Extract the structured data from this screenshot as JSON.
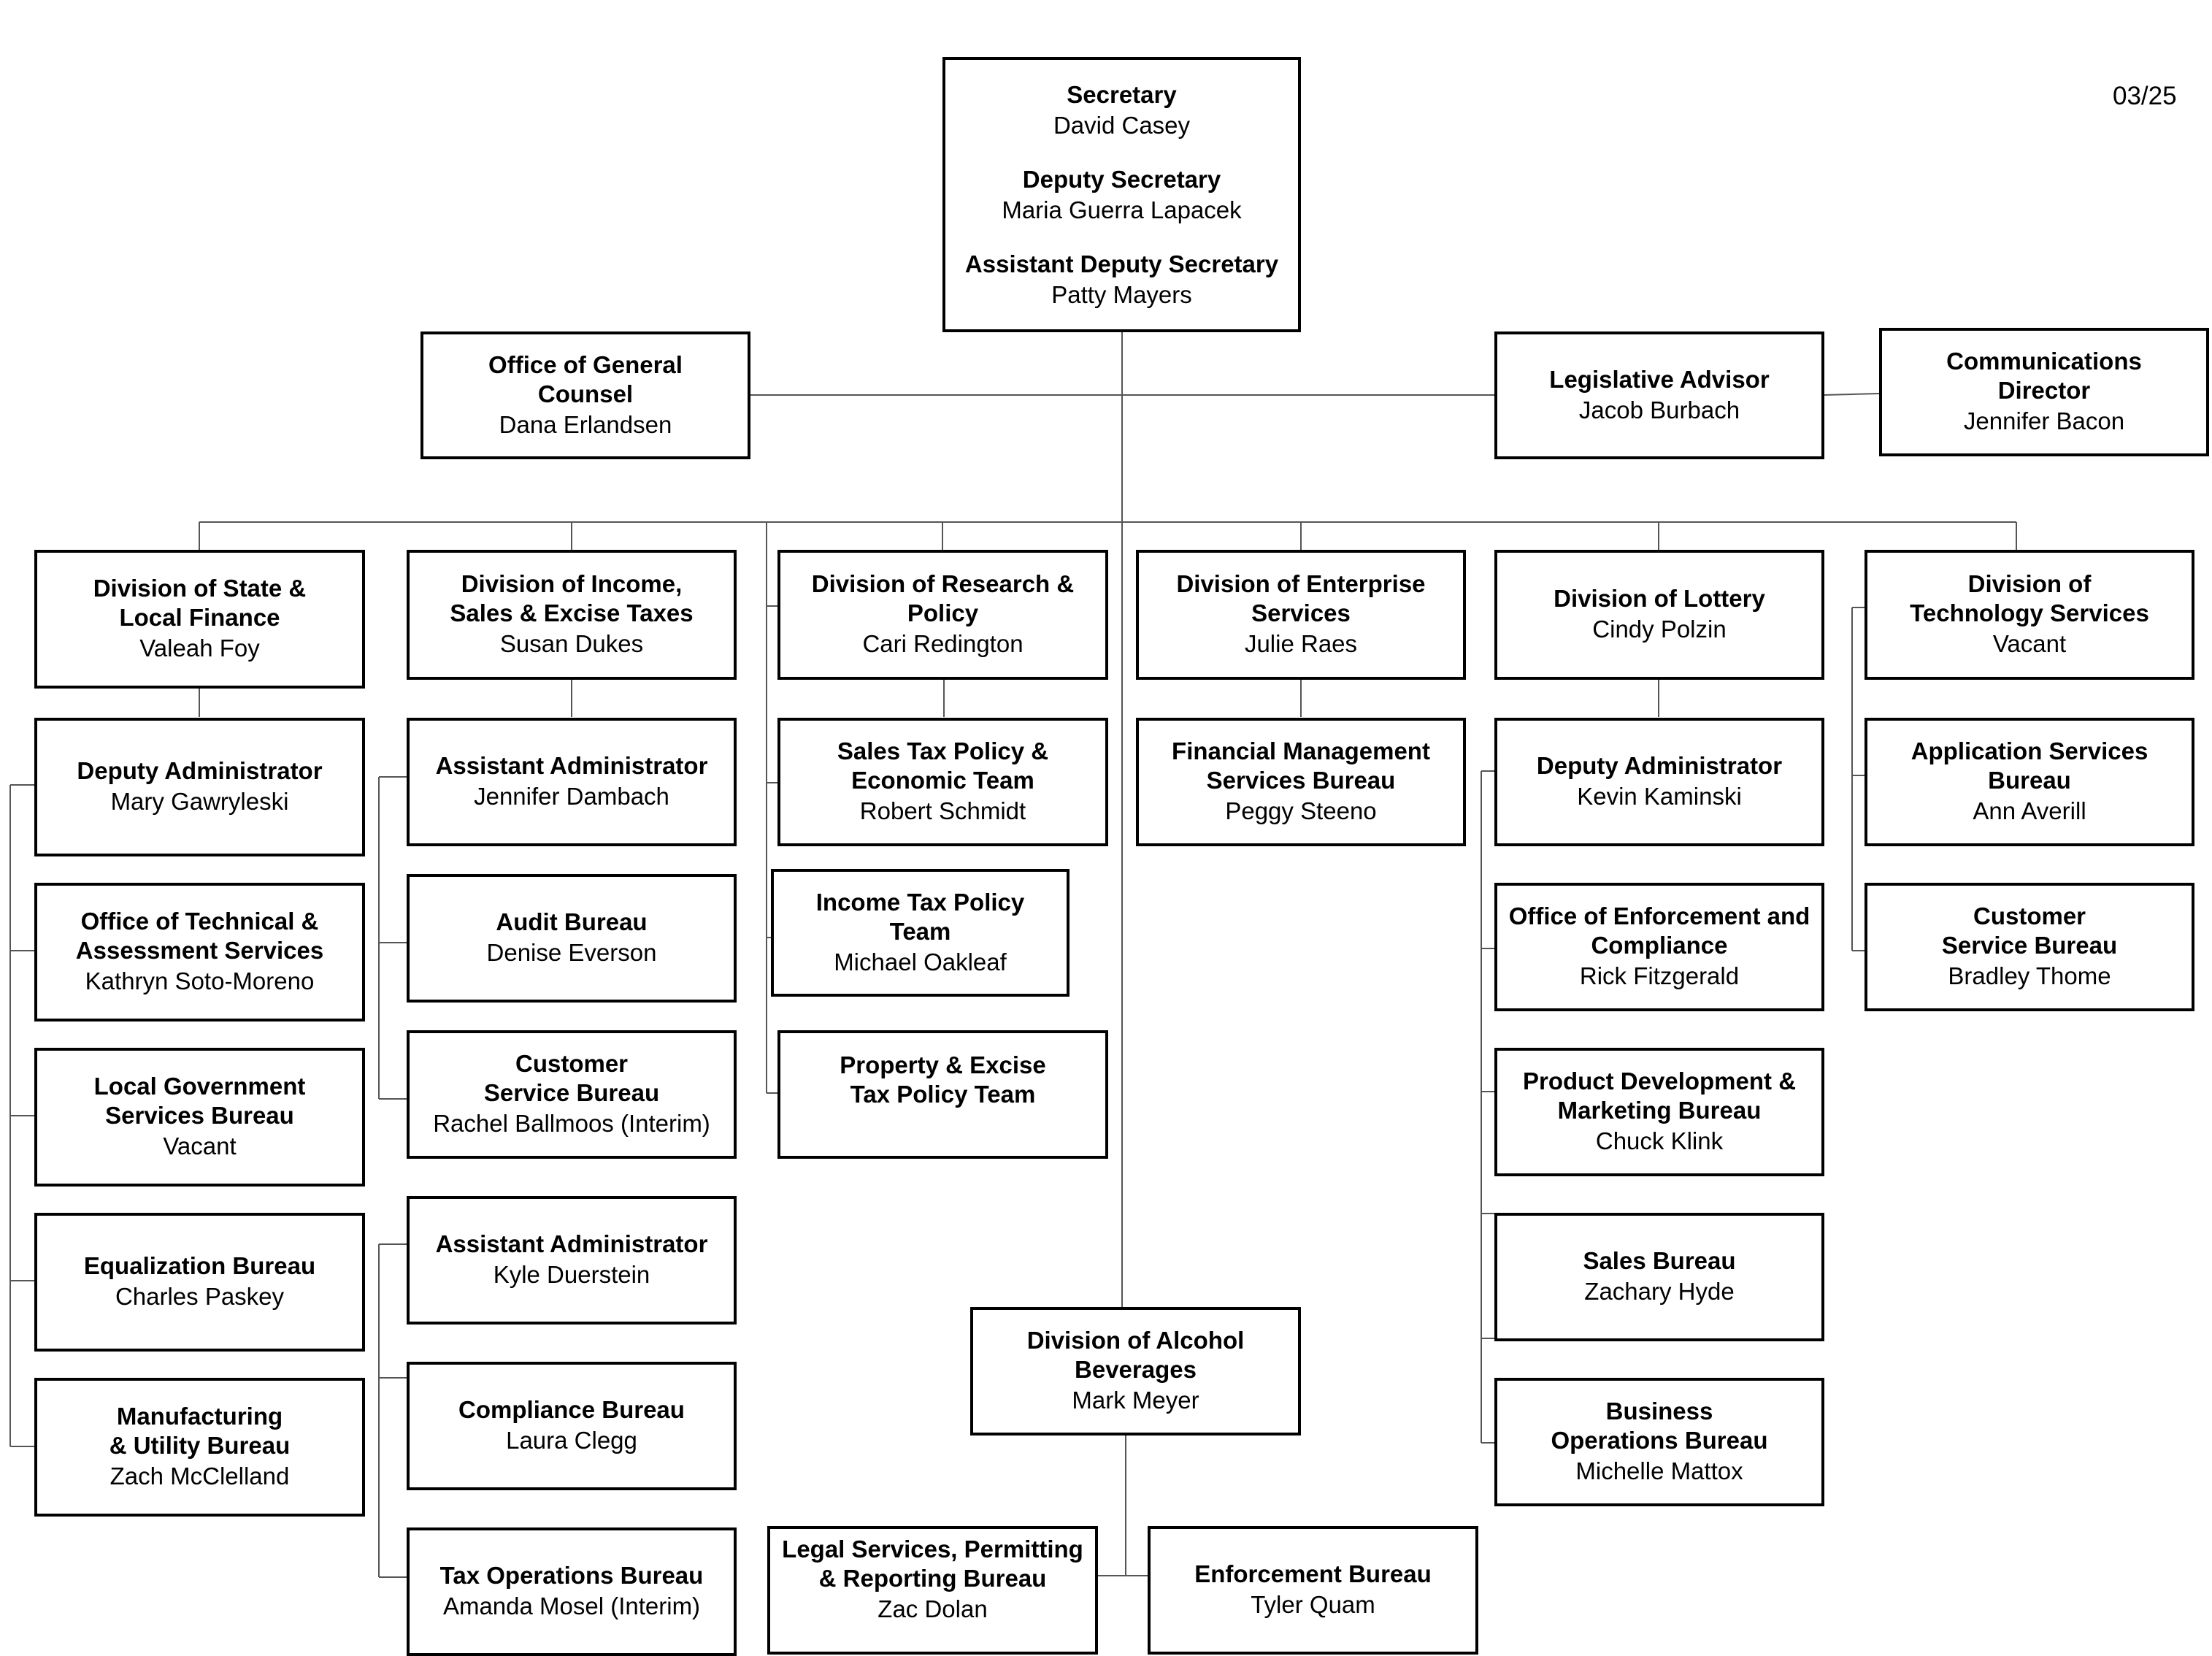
{
  "date_label": "03/25",
  "executive": {
    "roles": [
      {
        "title": "Secretary",
        "name": "David Casey"
      },
      {
        "title": "Deputy Secretary",
        "name": "Maria Guerra Lapacek"
      },
      {
        "title": "Assistant Deputy Secretary",
        "name": "Patty Mayers"
      }
    ]
  },
  "staff": {
    "general_counsel": {
      "title": "Office of General Counsel",
      "name": "Dana Erlandsen"
    },
    "legislative_advisor": {
      "title": "Legislative Advisor",
      "name": "Jacob Burbach"
    },
    "communications_director": {
      "title": "Communications Director",
      "name": "Jennifer Bacon"
    }
  },
  "divisions": [
    {
      "title": "Division of State & Local Finance",
      "name": "Valeah Foy",
      "units": [
        {
          "title": "Deputy Administrator",
          "name": "Mary Gawryleski"
        },
        {
          "title": "Office of Technical & Assessment Services",
          "name": "Kathryn Soto-Moreno"
        },
        {
          "title": "Local Government Services Bureau",
          "name": "Vacant"
        },
        {
          "title": "Equalization Bureau",
          "name": "Charles Paskey"
        },
        {
          "title": "Manufacturing & Utility Bureau",
          "name": "Zach McClelland"
        }
      ]
    },
    {
      "title": "Division of Income, Sales & Excise Taxes",
      "name": "Susan Dukes",
      "units": [
        {
          "title": "Assistant Administrator",
          "name": "Jennifer Dambach"
        },
        {
          "title": "Audit Bureau",
          "name": "Denise Everson"
        },
        {
          "title": "Customer Service Bureau",
          "name": "Rachel Ballmoos (Interim)"
        },
        {
          "title": "Assistant Administrator",
          "name": "Kyle Duerstein"
        },
        {
          "title": "Compliance Bureau",
          "name": "Laura Clegg"
        },
        {
          "title": "Tax Operations Bureau",
          "name": "Amanda Mosel (Interim)"
        }
      ]
    },
    {
      "title": "Division of Research & Policy",
      "name": "Cari Redington",
      "units": [
        {
          "title": "Sales Tax Policy & Economic Team",
          "name": "Robert Schmidt"
        },
        {
          "title": "Income Tax Policy Team",
          "name": "Michael Oakleaf"
        },
        {
          "title": "Property & Excise Tax Policy Team",
          "name": ""
        }
      ]
    },
    {
      "title": "Division of Enterprise Services",
      "name": "Julie Raes",
      "units": [
        {
          "title": "Financial Management Services Bureau",
          "name": "Peggy Steeno"
        }
      ]
    },
    {
      "title": "Division of Lottery",
      "name": "Cindy Polzin",
      "units": [
        {
          "title": "Deputy Administrator",
          "name": "Kevin Kaminski"
        },
        {
          "title": "Office of Enforcement and Compliance",
          "name": "Rick Fitzgerald"
        },
        {
          "title": "Product Development & Marketing Bureau",
          "name": "Chuck Klink"
        },
        {
          "title": "Sales Bureau",
          "name": "Zachary Hyde"
        },
        {
          "title": "Business Operations Bureau",
          "name": "Michelle Mattox"
        }
      ]
    },
    {
      "title": "Division of Technology Services",
      "name": "Vacant",
      "units": [
        {
          "title": "Application Services Bureau",
          "name": "Ann Averill"
        },
        {
          "title": "Customer Service Bureau",
          "name": "Bradley Thome"
        }
      ]
    },
    {
      "title": "Division of Alcohol Beverages",
      "name": "Mark Meyer",
      "units": [
        {
          "title": "Legal Services, Permitting & Reporting Bureau",
          "name": "Zac Dolan"
        },
        {
          "title": "Enforcement Bureau",
          "name": "Tyler Quam"
        }
      ]
    }
  ]
}
